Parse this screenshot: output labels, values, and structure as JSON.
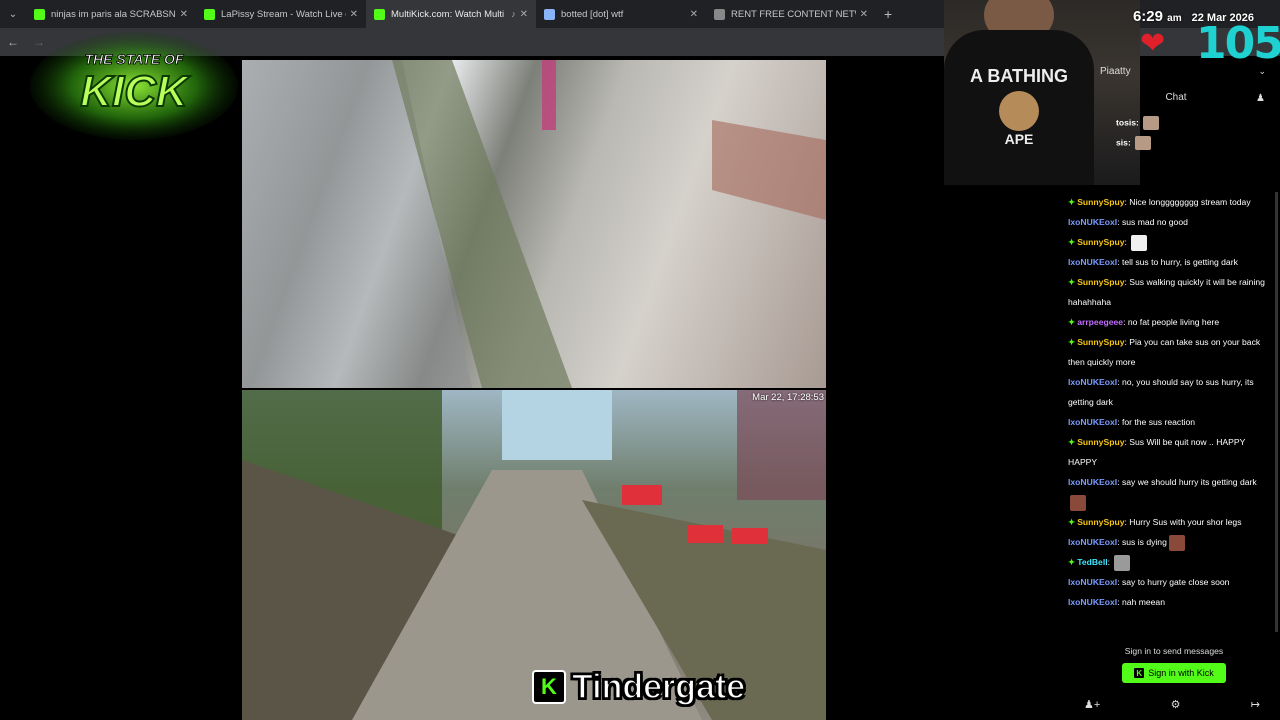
{
  "browser": {
    "tabs": [
      {
        "label": "ninjas im paris ala SCRABSNYC",
        "favicon_color": "#53fc18",
        "active": false
      },
      {
        "label": "LaPissy Stream - Watch Live on",
        "favicon_color": "#53fc18",
        "active": false
      },
      {
        "label": "MultiKick.com: Watch Multi",
        "favicon_color": "#53fc18",
        "active": true
      },
      {
        "label": "botted [dot] wtf",
        "favicon_color": "#8ab4f8",
        "active": false
      },
      {
        "label": "RENT FREE CONTENT NETWOR",
        "favicon_color": "#888888",
        "active": false
      }
    ],
    "new_tab": "+"
  },
  "overlay": {
    "logo_top": "THE STATE OF",
    "logo_main": "KICK",
    "time": "6:29",
    "ampm": "am",
    "date": "22 Mar 2026",
    "viewers": "105",
    "caption": "Tindergate",
    "caption_badge": "K",
    "video_timestamp": "Mar 22, 17:28:53"
  },
  "webcam": {
    "shirt_top": "A BATHING",
    "shirt_bottom": "APE"
  },
  "sidebar": {
    "user": "Piaatty",
    "chat_title": "Chat",
    "partial_rows": [
      "tosis:",
      "sis:"
    ],
    "messages": [
      {
        "badge": true,
        "name": "SunnySpuy",
        "color": "#f5c518",
        "text": "Nice longggggggg stream today"
      },
      {
        "badge": false,
        "name": "IxoNUKEoxI",
        "color": "#7a9cff",
        "text": "sus mad no good"
      },
      {
        "badge": true,
        "name": "SunnySpuy",
        "color": "#f5c518",
        "text": "",
        "emote": "#f0f0f0"
      },
      {
        "badge": false,
        "name": "IxoNUKEoxI",
        "color": "#7a9cff",
        "text": "tell sus to hurry, is getting dark"
      },
      {
        "badge": true,
        "name": "SunnySpuy",
        "color": "#f5c518",
        "text": "Sus walking quickly it will be raining hahahhaha"
      },
      {
        "badge": true,
        "name": "arrpeegeee",
        "color": "#c36cff",
        "text": "no fat people living here"
      },
      {
        "badge": true,
        "name": "SunnySpuy",
        "color": "#f5c518",
        "text": "Pia you can take sus on your back then quickly more"
      },
      {
        "badge": false,
        "name": "IxoNUKEoxI",
        "color": "#7a9cff",
        "text": "no, you should say to sus hurry, its getting dark"
      },
      {
        "badge": false,
        "name": "IxoNUKEoxI",
        "color": "#7a9cff",
        "text": "for the sus reaction"
      },
      {
        "badge": true,
        "name": "SunnySpuy",
        "color": "#f5c518",
        "text": "Sus Will be quit now .. HAPPY HAPPY"
      },
      {
        "badge": false,
        "name": "IxoNUKEoxI",
        "color": "#7a9cff",
        "text": "say we should hurry its getting dark",
        "emote": "#8a4a3a"
      },
      {
        "badge": true,
        "name": "SunnySpuy",
        "color": "#f5c518",
        "text": "Hurry Sus with your shor legs"
      },
      {
        "badge": false,
        "name": "IxoNUKEoxI",
        "color": "#7a9cff",
        "text": "sus is dying",
        "emote": "#8a4a3a"
      },
      {
        "badge": true,
        "name": "TedBell",
        "color": "#3ee6ff",
        "text": "",
        "emote": "#9a9a9a"
      },
      {
        "badge": false,
        "name": "IxoNUKEoxI",
        "color": "#7a9cff",
        "text": "say to hurry gate close soon"
      },
      {
        "badge": false,
        "name": "IxoNUKEoxI",
        "color": "#7a9cff",
        "text": "nah meean"
      }
    ],
    "signin_text": "Sign in to send messages",
    "signin_button": "Sign in with Kick"
  }
}
